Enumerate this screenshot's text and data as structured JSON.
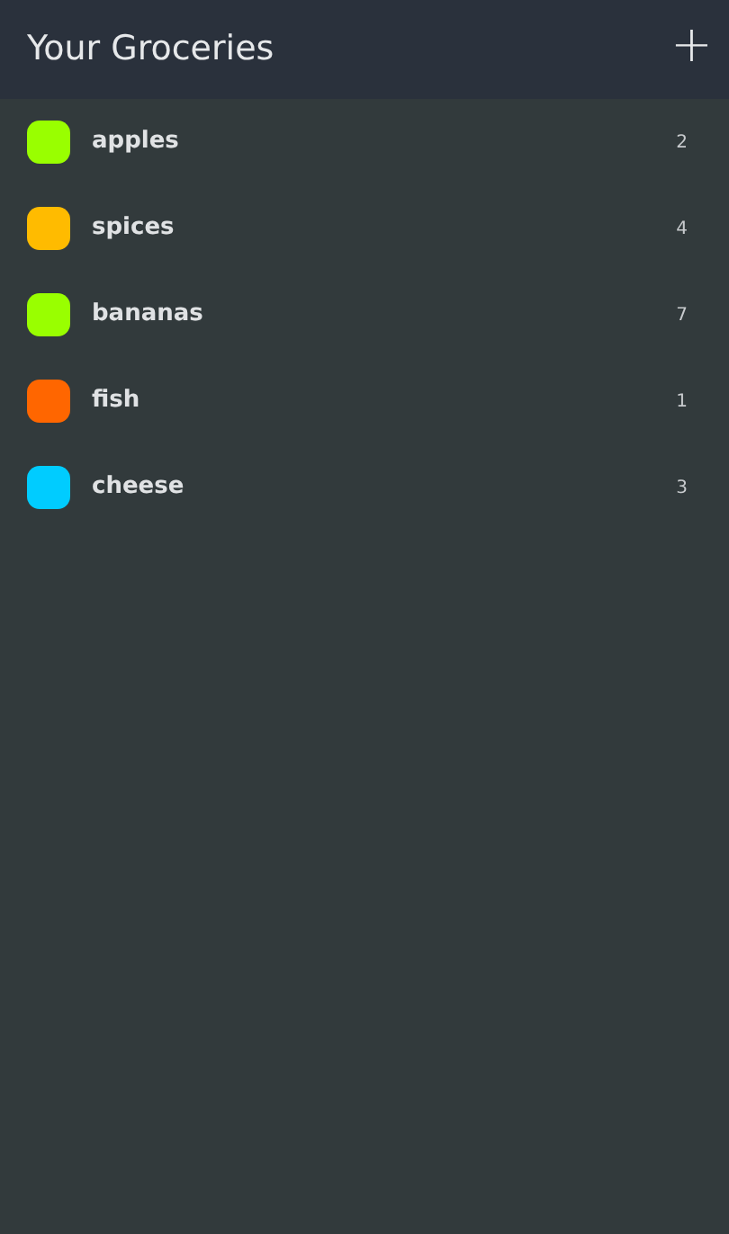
{
  "header": {
    "title": "Your Groceries",
    "add_button": "+"
  },
  "items": [
    {
      "name": "apples",
      "count": "2",
      "color": "#99ff00"
    },
    {
      "name": "spices",
      "count": "4",
      "color": "#ffbb00"
    },
    {
      "name": "bananas",
      "count": "7",
      "color": "#99ff00"
    },
    {
      "name": "fish",
      "count": "1",
      "color": "#ff6600"
    },
    {
      "name": "cheese",
      "count": "3",
      "color": "#00ccff"
    }
  ]
}
